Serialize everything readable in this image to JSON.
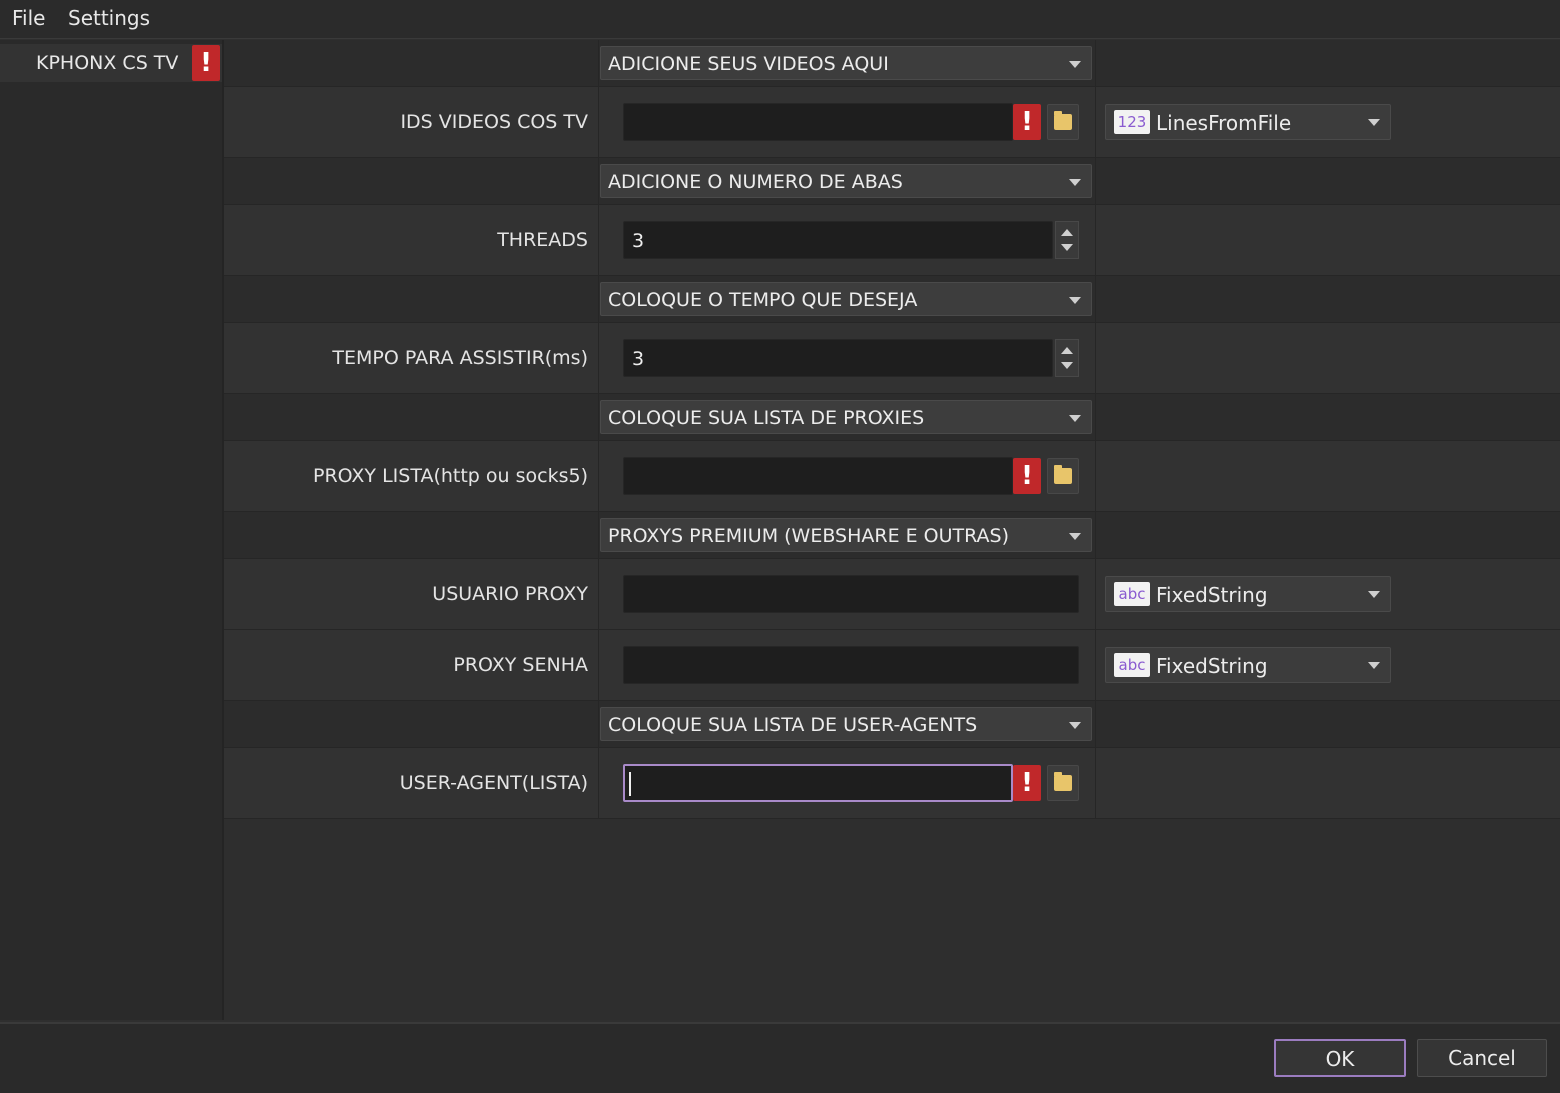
{
  "menu": {
    "file": "File",
    "settings": "Settings"
  },
  "sidebar": {
    "items": [
      {
        "label": "KPHONX CS TV",
        "error": "!"
      }
    ]
  },
  "sections": [
    "ADICIONE SEUS VIDEOS AQUI",
    "ADICIONE O NUMERO DE ABAS",
    "COLOQUE O TEMPO QUE DESEJA",
    "COLOQUE SUA LISTA DE PROXIES",
    "PROXYS PREMIUM (WEBSHARE E OUTRAS)",
    "COLOQUE SUA LISTA DE USER-AGENTS"
  ],
  "fields": {
    "ids_videos": {
      "label": "IDS VIDEOS COS TV",
      "value": "",
      "error": "!",
      "type_icon": "123",
      "type": "LinesFromFile"
    },
    "threads": {
      "label": "THREADS",
      "value": "3"
    },
    "tempo": {
      "label": "TEMPO PARA ASSISTIR(ms)",
      "value": "3"
    },
    "proxy_lista": {
      "label": "PROXY LISTA(http ou socks5)",
      "value": "",
      "error": "!"
    },
    "usuario_proxy": {
      "label": "USUARIO PROXY",
      "value": "",
      "type_icon": "abc",
      "type": "FixedString"
    },
    "proxy_senha": {
      "label": "PROXY SENHA",
      "value": "",
      "type_icon": "abc",
      "type": "FixedString"
    },
    "user_agent": {
      "label": "USER-AGENT(LISTA)",
      "value": "",
      "error": "!"
    }
  },
  "footer": {
    "ok": "OK",
    "cancel": "Cancel"
  }
}
